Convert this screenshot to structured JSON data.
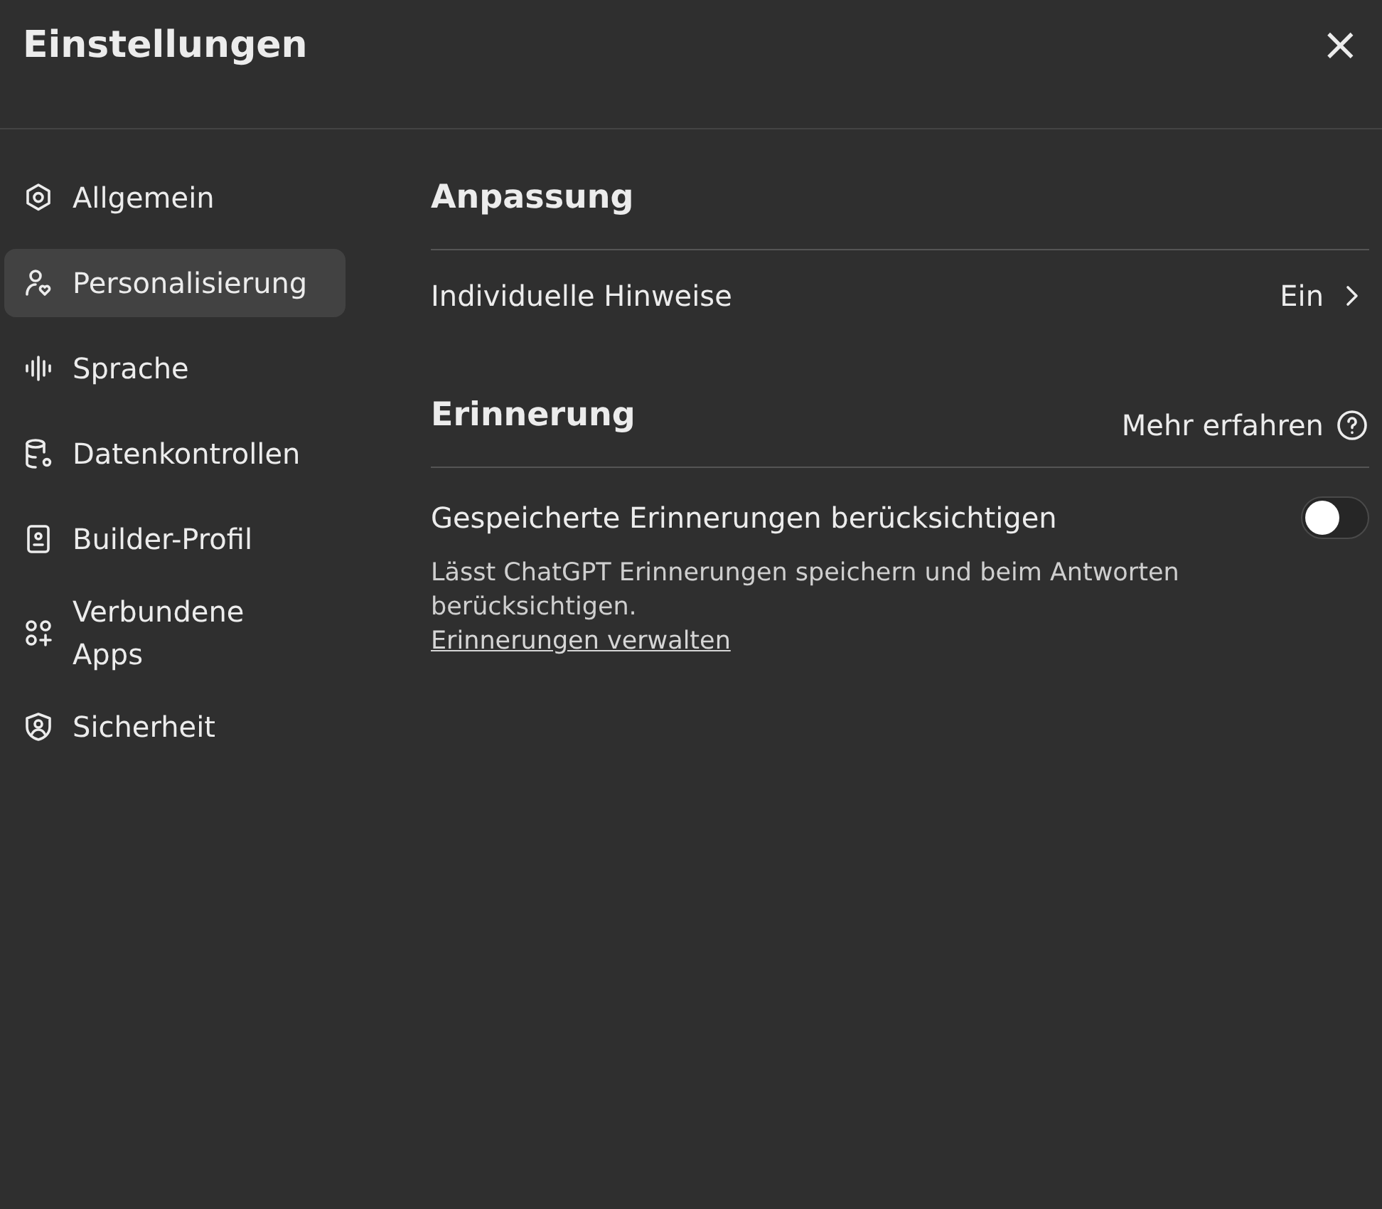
{
  "dialog": {
    "title": "Einstellungen",
    "close": "×"
  },
  "sidebar": {
    "items": [
      {
        "label": "Allgemein",
        "selected": false
      },
      {
        "label": "Personalisierung",
        "selected": true
      },
      {
        "label": "Sprache",
        "selected": false
      },
      {
        "label": "Datenkontrollen",
        "selected": false
      },
      {
        "label": "Builder-Profil",
        "selected": false
      },
      {
        "label": "Verbundene Apps",
        "selected": false
      },
      {
        "label": "Sicherheit",
        "selected": false
      }
    ]
  },
  "sections": [
    {
      "title": "Anpassung",
      "rows": [
        {
          "kind": "link",
          "label": "Individuelle Hinweise",
          "value": "Ein"
        }
      ]
    },
    {
      "title": "Erinnerung",
      "help": "Mehr erfahren",
      "rows": [
        {
          "kind": "toggle",
          "label": "Gespeicherte Erinnerungen berücksichtigen",
          "on": false,
          "description": "Lässt ChatGPT Erinnerungen speichern und beim Antworten berücksichtigen.",
          "link": "Erinnerungen verwalten"
        }
      ]
    }
  ]
}
